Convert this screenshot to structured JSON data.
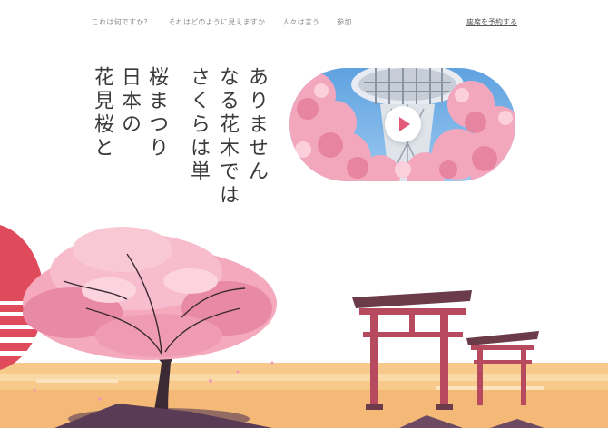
{
  "nav": {
    "items": [
      "これは何ですか？",
      "それはどのように見えますか",
      "人々は言う",
      "参加"
    ],
    "book_label": "座席を予約する"
  },
  "hero": {
    "columns": [
      "ありません",
      "なる花木では",
      "さくらは単",
      "桜まつり",
      "日本の",
      "花見桜と"
    ]
  },
  "video": {
    "play_icon": "play-icon"
  },
  "colors": {
    "accent": "#e35a78",
    "sun": "#e04b5c",
    "torii": "#b84a5f",
    "ground": "#f7c98a"
  }
}
